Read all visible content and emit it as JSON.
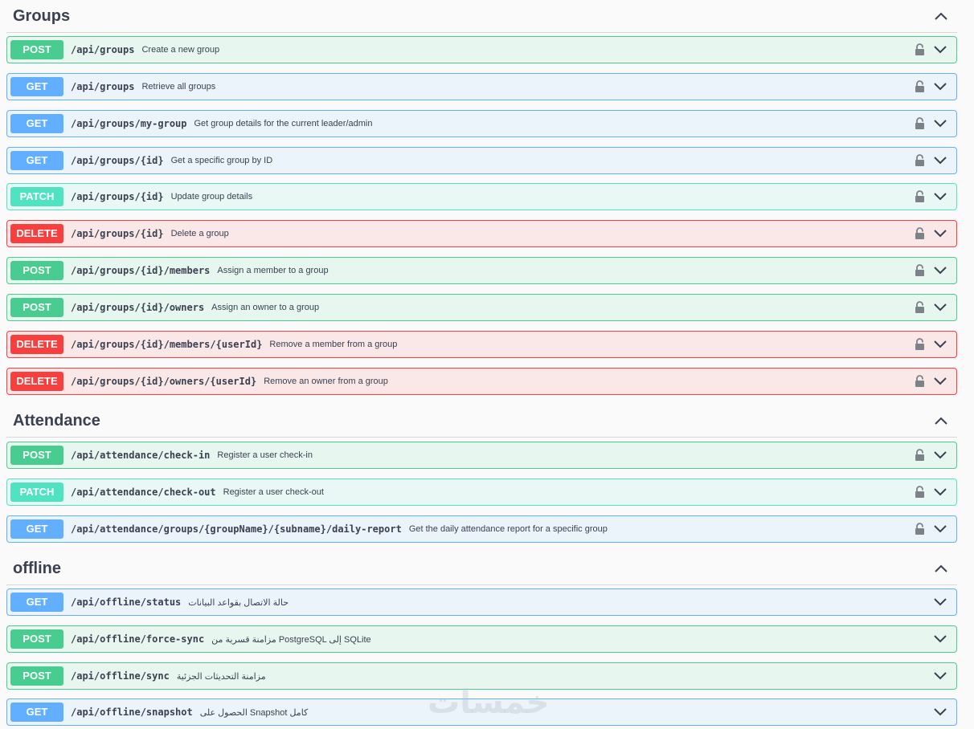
{
  "sections": {
    "groups": {
      "title": "Groups",
      "operations": [
        {
          "method": "POST",
          "path": "/api/groups",
          "summary": "Create a new group"
        },
        {
          "method": "GET",
          "path": "/api/groups",
          "summary": "Retrieve all groups"
        },
        {
          "method": "GET",
          "path": "/api/groups/my-group",
          "summary": "Get group details for the current leader/admin"
        },
        {
          "method": "GET",
          "path": "/api/groups/{id}",
          "summary": "Get a specific group by ID"
        },
        {
          "method": "PATCH",
          "path": "/api/groups/{id}",
          "summary": "Update group details"
        },
        {
          "method": "DELETE",
          "path": "/api/groups/{id}",
          "summary": "Delete a group"
        },
        {
          "method": "POST",
          "path": "/api/groups/{id}/members",
          "summary": "Assign a member to a group"
        },
        {
          "method": "POST",
          "path": "/api/groups/{id}/owners",
          "summary": "Assign an owner to a group"
        },
        {
          "method": "DELETE",
          "path": "/api/groups/{id}/members/{userId}",
          "summary": "Remove a member from a group"
        },
        {
          "method": "DELETE",
          "path": "/api/groups/{id}/owners/{userId}",
          "summary": "Remove an owner from a group"
        }
      ]
    },
    "attendance": {
      "title": "Attendance",
      "operations": [
        {
          "method": "POST",
          "path": "/api/attendance/check-in",
          "summary": "Register a user check-in"
        },
        {
          "method": "PATCH",
          "path": "/api/attendance/check-out",
          "summary": "Register a user check-out"
        },
        {
          "method": "GET",
          "path": "/api/attendance/groups/{groupName}/{subname}/daily-report",
          "summary": "Get the daily attendance report for a specific group"
        }
      ]
    },
    "offline": {
      "title": "offline",
      "operations": [
        {
          "method": "GET",
          "path": "/api/offline/status",
          "summary": "حالة الاتصال بقواعد البيانات"
        },
        {
          "method": "POST",
          "path": "/api/offline/force-sync",
          "summary": "مزامنة قسرية من PostgreSQL إلى SQLite"
        },
        {
          "method": "POST",
          "path": "/api/offline/sync",
          "summary": "مزامنة التحديثات الجزئية"
        },
        {
          "method": "GET",
          "path": "/api/offline/snapshot",
          "summary": "الحصول على Snapshot كامل"
        }
      ]
    }
  },
  "watermark": "خمسات",
  "icons": {
    "collapse": "chevron-up-icon",
    "expand": "chevron-down-icon",
    "lock": "lock-icon"
  },
  "colors": {
    "post": "#49cc90",
    "get": "#61affe",
    "patch": "#50e3c2",
    "delete": "#f93e3e"
  }
}
